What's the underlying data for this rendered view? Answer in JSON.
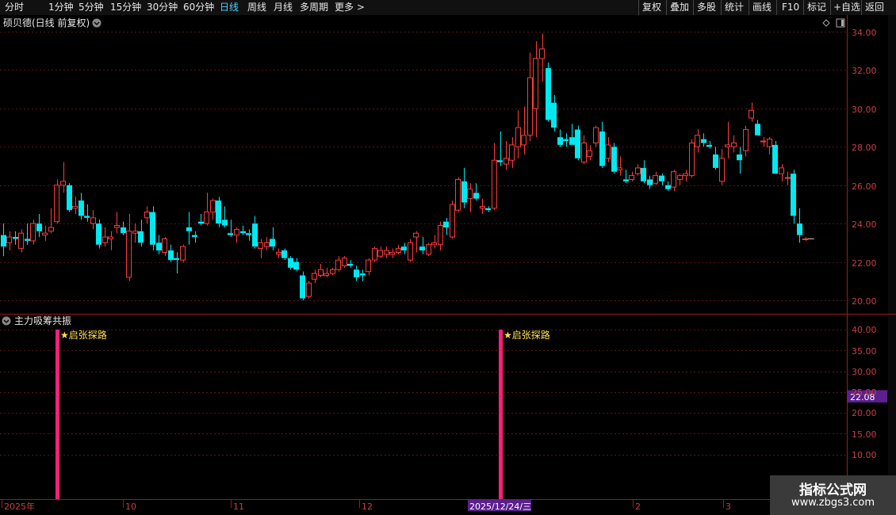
{
  "toolbar": {
    "periods": [
      "分时",
      "1分钟",
      "5分钟",
      "15分钟",
      "30分钟",
      "60分钟",
      "日线",
      "周线",
      "月线",
      "多周期",
      "更多 >"
    ],
    "active_period": "日线",
    "actions": [
      "复权",
      "叠加",
      "多股",
      "统计",
      "画线",
      "F10",
      "标记",
      "+自选",
      "返回"
    ]
  },
  "stock": {
    "title": "硕贝德(日线 前复权)"
  },
  "indicator": {
    "title": "主力吸筹共振",
    "signal_label": "★启张探路",
    "current_value": "22.08"
  },
  "price_axis": {
    "ticks": [
      "34.00",
      "32.00",
      "30.00",
      "28.00",
      "26.00",
      "24.00",
      "22.00",
      "20.00"
    ]
  },
  "indicator_axis": {
    "ticks": [
      "40.00",
      "35.00",
      "30.00",
      "25.00",
      "20.00",
      "15.00",
      "10.00"
    ]
  },
  "time_axis": {
    "labels": [
      "2025年",
      "10",
      "11",
      "12",
      "2025/12/24/三",
      "2",
      "3"
    ]
  },
  "watermark": {
    "line1": "指标公式网",
    "line2": "www.zbgs3.com"
  },
  "colors": {
    "up": "#ff3b3b",
    "down": "#00e8f0",
    "signal": "#ff1e78",
    "grid": "#5a1414",
    "highlight": "#5b1f8f"
  },
  "chart_data": {
    "type": "candlestick",
    "price_ylim": [
      20,
      34
    ],
    "candles": [
      {
        "o": 23.4,
        "h": 24.0,
        "l": 22.3,
        "c": 22.8
      },
      {
        "o": 23.0,
        "h": 23.6,
        "l": 22.6,
        "c": 23.3
      },
      {
        "o": 23.3,
        "h": 23.6,
        "l": 22.9,
        "c": 23.2
      },
      {
        "o": 22.7,
        "h": 23.7,
        "l": 22.5,
        "c": 23.5
      },
      {
        "o": 23.2,
        "h": 24.0,
        "l": 22.9,
        "c": 23.1
      },
      {
        "o": 23.1,
        "h": 24.2,
        "l": 22.9,
        "c": 24.0
      },
      {
        "o": 24.0,
        "h": 24.5,
        "l": 23.3,
        "c": 23.6
      },
      {
        "o": 23.4,
        "h": 23.9,
        "l": 23.1,
        "c": 23.5
      },
      {
        "o": 23.6,
        "h": 24.8,
        "l": 23.5,
        "c": 23.8
      },
      {
        "o": 24.1,
        "h": 26.3,
        "l": 24.0,
        "c": 26.0
      },
      {
        "o": 26.0,
        "h": 27.2,
        "l": 25.6,
        "c": 26.2
      },
      {
        "o": 26.0,
        "h": 26.1,
        "l": 24.6,
        "c": 24.7
      },
      {
        "o": 24.8,
        "h": 25.4,
        "l": 24.5,
        "c": 24.9
      },
      {
        "o": 25.2,
        "h": 25.6,
        "l": 24.2,
        "c": 24.4
      },
      {
        "o": 24.4,
        "h": 25.0,
        "l": 24.1,
        "c": 24.3
      },
      {
        "o": 24.0,
        "h": 24.7,
        "l": 23.7,
        "c": 24.3
      },
      {
        "o": 24.0,
        "h": 24.2,
        "l": 22.7,
        "c": 22.9
      },
      {
        "o": 23.0,
        "h": 23.8,
        "l": 22.8,
        "c": 23.3
      },
      {
        "o": 23.2,
        "h": 23.6,
        "l": 22.6,
        "c": 23.3
      },
      {
        "o": 23.8,
        "h": 24.6,
        "l": 23.5,
        "c": 23.9
      },
      {
        "o": 23.8,
        "h": 24.1,
        "l": 23.4,
        "c": 23.5
      },
      {
        "o": 21.2,
        "h": 24.5,
        "l": 21.0,
        "c": 23.6
      },
      {
        "o": 23.5,
        "h": 24.0,
        "l": 23.0,
        "c": 23.6
      },
      {
        "o": 23.6,
        "h": 24.2,
        "l": 22.8,
        "c": 23.0
      },
      {
        "o": 24.3,
        "h": 24.9,
        "l": 24.0,
        "c": 24.6
      },
      {
        "o": 24.6,
        "h": 24.9,
        "l": 22.6,
        "c": 22.9
      },
      {
        "o": 23.0,
        "h": 23.4,
        "l": 22.4,
        "c": 22.6
      },
      {
        "o": 22.5,
        "h": 23.3,
        "l": 22.3,
        "c": 23.2
      },
      {
        "o": 22.6,
        "h": 22.9,
        "l": 22.0,
        "c": 22.1
      },
      {
        "o": 22.2,
        "h": 22.5,
        "l": 21.4,
        "c": 22.1
      },
      {
        "o": 22.1,
        "h": 22.9,
        "l": 22.0,
        "c": 22.8
      },
      {
        "o": 23.8,
        "h": 24.6,
        "l": 22.9,
        "c": 23.6
      },
      {
        "o": 23.4,
        "h": 23.6,
        "l": 23.0,
        "c": 23.3
      },
      {
        "o": 24.1,
        "h": 24.5,
        "l": 23.9,
        "c": 24.0
      },
      {
        "o": 24.0,
        "h": 25.6,
        "l": 23.9,
        "c": 24.6
      },
      {
        "o": 24.6,
        "h": 25.3,
        "l": 24.2,
        "c": 25.2
      },
      {
        "o": 25.2,
        "h": 25.4,
        "l": 23.8,
        "c": 24.0
      },
      {
        "o": 24.2,
        "h": 24.9,
        "l": 23.8,
        "c": 23.9
      },
      {
        "o": 23.5,
        "h": 24.2,
        "l": 23.3,
        "c": 23.4
      },
      {
        "o": 23.4,
        "h": 23.8,
        "l": 23.0,
        "c": 23.7
      },
      {
        "o": 23.6,
        "h": 23.9,
        "l": 23.4,
        "c": 23.5
      },
      {
        "o": 23.5,
        "h": 23.7,
        "l": 23.1,
        "c": 23.4
      },
      {
        "o": 24.0,
        "h": 24.4,
        "l": 22.7,
        "c": 22.8
      },
      {
        "o": 22.7,
        "h": 23.2,
        "l": 22.2,
        "c": 23.0
      },
      {
        "o": 22.8,
        "h": 23.3,
        "l": 22.6,
        "c": 23.0
      },
      {
        "o": 23.2,
        "h": 23.8,
        "l": 22.6,
        "c": 22.8
      },
      {
        "o": 22.4,
        "h": 22.7,
        "l": 22.2,
        "c": 22.5
      },
      {
        "o": 22.6,
        "h": 22.7,
        "l": 22.1,
        "c": 22.2
      },
      {
        "o": 22.2,
        "h": 22.3,
        "l": 21.6,
        "c": 21.7
      },
      {
        "o": 22.0,
        "h": 22.2,
        "l": 21.5,
        "c": 21.6
      },
      {
        "o": 21.3,
        "h": 21.5,
        "l": 20.0,
        "c": 20.1
      },
      {
        "o": 20.2,
        "h": 21.0,
        "l": 20.1,
        "c": 20.9
      },
      {
        "o": 21.1,
        "h": 21.6,
        "l": 20.9,
        "c": 21.4
      },
      {
        "o": 21.3,
        "h": 21.9,
        "l": 21.2,
        "c": 21.6
      },
      {
        "o": 21.3,
        "h": 21.7,
        "l": 21.2,
        "c": 21.4
      },
      {
        "o": 21.4,
        "h": 21.7,
        "l": 21.3,
        "c": 21.6
      },
      {
        "o": 21.6,
        "h": 22.3,
        "l": 21.5,
        "c": 22.1
      },
      {
        "o": 21.8,
        "h": 22.3,
        "l": 21.7,
        "c": 22.2
      },
      {
        "o": 21.9,
        "h": 22.1,
        "l": 21.7,
        "c": 21.8
      },
      {
        "o": 21.6,
        "h": 21.8,
        "l": 21.0,
        "c": 21.2
      },
      {
        "o": 21.4,
        "h": 21.6,
        "l": 21.0,
        "c": 21.3
      },
      {
        "o": 21.5,
        "h": 22.2,
        "l": 21.3,
        "c": 22.1
      },
      {
        "o": 22.1,
        "h": 22.8,
        "l": 22.0,
        "c": 22.7
      },
      {
        "o": 22.3,
        "h": 22.8,
        "l": 22.2,
        "c": 22.6
      },
      {
        "o": 22.4,
        "h": 22.8,
        "l": 22.2,
        "c": 22.6
      },
      {
        "o": 22.4,
        "h": 22.7,
        "l": 22.2,
        "c": 22.5
      },
      {
        "o": 22.5,
        "h": 22.9,
        "l": 22.4,
        "c": 22.7
      },
      {
        "o": 22.8,
        "h": 23.0,
        "l": 22.4,
        "c": 22.6
      },
      {
        "o": 22.1,
        "h": 23.2,
        "l": 22.0,
        "c": 23.0
      },
      {
        "o": 23.3,
        "h": 23.6,
        "l": 22.5,
        "c": 23.5
      },
      {
        "o": 22.8,
        "h": 23.3,
        "l": 22.4,
        "c": 22.6
      },
      {
        "o": 22.4,
        "h": 23.0,
        "l": 22.3,
        "c": 22.9
      },
      {
        "o": 22.9,
        "h": 23.4,
        "l": 22.7,
        "c": 23.0
      },
      {
        "o": 22.9,
        "h": 24.1,
        "l": 22.6,
        "c": 23.9
      },
      {
        "o": 24.1,
        "h": 24.3,
        "l": 23.4,
        "c": 23.8
      },
      {
        "o": 23.3,
        "h": 25.2,
        "l": 23.2,
        "c": 25.0
      },
      {
        "o": 24.7,
        "h": 26.4,
        "l": 24.6,
        "c": 26.3
      },
      {
        "o": 26.2,
        "h": 26.9,
        "l": 24.8,
        "c": 25.1
      },
      {
        "o": 25.3,
        "h": 26.1,
        "l": 24.6,
        "c": 25.8
      },
      {
        "o": 25.6,
        "h": 26.1,
        "l": 25.2,
        "c": 25.3
      },
      {
        "o": 24.8,
        "h": 25.3,
        "l": 24.5,
        "c": 24.9
      },
      {
        "o": 24.8,
        "h": 24.9,
        "l": 24.6,
        "c": 24.7
      },
      {
        "o": 24.8,
        "h": 28.2,
        "l": 24.7,
        "c": 27.3
      },
      {
        "o": 27.3,
        "h": 28.8,
        "l": 27.0,
        "c": 27.2
      },
      {
        "o": 27.1,
        "h": 28.3,
        "l": 26.8,
        "c": 27.4
      },
      {
        "o": 27.3,
        "h": 28.5,
        "l": 26.9,
        "c": 28.1
      },
      {
        "o": 28.0,
        "h": 29.9,
        "l": 27.4,
        "c": 29.0
      },
      {
        "o": 28.1,
        "h": 30.1,
        "l": 27.6,
        "c": 28.6
      },
      {
        "o": 28.6,
        "h": 32.9,
        "l": 28.3,
        "c": 31.6
      },
      {
        "o": 30.0,
        "h": 33.5,
        "l": 28.5,
        "c": 32.6
      },
      {
        "o": 32.6,
        "h": 33.9,
        "l": 31.4,
        "c": 33.1
      },
      {
        "o": 32.1,
        "h": 32.4,
        "l": 29.3,
        "c": 29.4
      },
      {
        "o": 30.3,
        "h": 30.7,
        "l": 28.8,
        "c": 29.0
      },
      {
        "o": 28.5,
        "h": 28.9,
        "l": 28.0,
        "c": 28.1
      },
      {
        "o": 28.4,
        "h": 28.7,
        "l": 28.0,
        "c": 28.3
      },
      {
        "o": 28.5,
        "h": 29.2,
        "l": 28.1,
        "c": 28.1
      },
      {
        "o": 28.9,
        "h": 29.1,
        "l": 27.3,
        "c": 27.4
      },
      {
        "o": 27.2,
        "h": 28.6,
        "l": 27.1,
        "c": 28.2
      },
      {
        "o": 27.5,
        "h": 28.1,
        "l": 27.3,
        "c": 27.8
      },
      {
        "o": 28.2,
        "h": 29.1,
        "l": 28.0,
        "c": 29.0
      },
      {
        "o": 28.8,
        "h": 29.3,
        "l": 26.9,
        "c": 27.0
      },
      {
        "o": 27.4,
        "h": 28.5,
        "l": 27.2,
        "c": 28.1
      },
      {
        "o": 28.0,
        "h": 28.2,
        "l": 26.6,
        "c": 26.7
      },
      {
        "o": 26.8,
        "h": 27.5,
        "l": 26.5,
        "c": 26.9
      },
      {
        "o": 26.3,
        "h": 26.8,
        "l": 26.1,
        "c": 26.2
      },
      {
        "o": 26.3,
        "h": 26.7,
        "l": 26.2,
        "c": 26.5
      },
      {
        "o": 26.6,
        "h": 27.1,
        "l": 26.5,
        "c": 26.9
      },
      {
        "o": 26.9,
        "h": 27.3,
        "l": 26.1,
        "c": 26.2
      },
      {
        "o": 26.3,
        "h": 26.5,
        "l": 25.8,
        "c": 26.0
      },
      {
        "o": 26.1,
        "h": 26.7,
        "l": 26.0,
        "c": 26.5
      },
      {
        "o": 26.5,
        "h": 26.6,
        "l": 26.0,
        "c": 26.2
      },
      {
        "o": 26.0,
        "h": 26.2,
        "l": 25.7,
        "c": 25.8
      },
      {
        "o": 25.9,
        "h": 26.8,
        "l": 25.7,
        "c": 26.7
      },
      {
        "o": 26.3,
        "h": 26.6,
        "l": 26.0,
        "c": 26.5
      },
      {
        "o": 26.5,
        "h": 26.8,
        "l": 26.2,
        "c": 26.6
      },
      {
        "o": 26.5,
        "h": 28.4,
        "l": 26.4,
        "c": 28.2
      },
      {
        "o": 28.0,
        "h": 28.9,
        "l": 27.7,
        "c": 28.6
      },
      {
        "o": 28.4,
        "h": 28.7,
        "l": 28.0,
        "c": 28.2
      },
      {
        "o": 28.1,
        "h": 28.3,
        "l": 27.9,
        "c": 28.0
      },
      {
        "o": 27.6,
        "h": 28.0,
        "l": 26.8,
        "c": 26.9
      },
      {
        "o": 26.2,
        "h": 27.9,
        "l": 26.0,
        "c": 27.4
      },
      {
        "o": 28.0,
        "h": 29.3,
        "l": 27.4,
        "c": 28.1
      },
      {
        "o": 28.0,
        "h": 28.6,
        "l": 27.7,
        "c": 28.2
      },
      {
        "o": 27.6,
        "h": 28.0,
        "l": 26.6,
        "c": 27.3
      },
      {
        "o": 27.8,
        "h": 29.1,
        "l": 27.5,
        "c": 28.9
      },
      {
        "o": 29.5,
        "h": 30.3,
        "l": 29.3,
        "c": 29.9
      },
      {
        "o": 29.2,
        "h": 29.4,
        "l": 28.6,
        "c": 28.6
      },
      {
        "o": 28.3,
        "h": 28.5,
        "l": 28.0,
        "c": 28.3
      },
      {
        "o": 28.0,
        "h": 28.5,
        "l": 27.6,
        "c": 28.4
      },
      {
        "o": 28.1,
        "h": 28.3,
        "l": 26.6,
        "c": 26.6
      },
      {
        "o": 26.6,
        "h": 27.1,
        "l": 26.2,
        "c": 26.9
      },
      {
        "o": 26.4,
        "h": 26.7,
        "l": 26.0,
        "c": 26.4
      },
      {
        "o": 26.6,
        "h": 26.8,
        "l": 24.0,
        "c": 24.4
      },
      {
        "o": 24.0,
        "h": 24.8,
        "l": 23.0,
        "c": 23.4
      },
      {
        "o": 23.2,
        "h": 23.3,
        "l": 23.1,
        "c": 23.2
      }
    ],
    "indicator": {
      "ylim": [
        0,
        42
      ],
      "signal_bars": [
        {
          "index": 9,
          "value": 40
        },
        {
          "index": 83,
          "value": 40
        }
      ]
    }
  }
}
